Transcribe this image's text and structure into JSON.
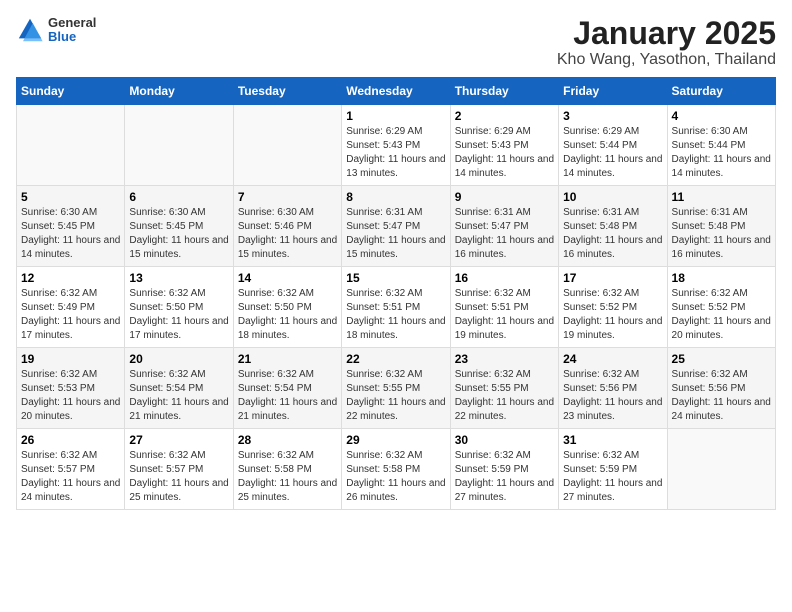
{
  "logo": {
    "general": "General",
    "blue": "Blue"
  },
  "title": "January 2025",
  "subtitle": "Kho Wang, Yasothon, Thailand",
  "days_of_week": [
    "Sunday",
    "Monday",
    "Tuesday",
    "Wednesday",
    "Thursday",
    "Friday",
    "Saturday"
  ],
  "weeks": [
    [
      {
        "day": "",
        "info": ""
      },
      {
        "day": "",
        "info": ""
      },
      {
        "day": "",
        "info": ""
      },
      {
        "day": "1",
        "info": "Sunrise: 6:29 AM\nSunset: 5:43 PM\nDaylight: 11 hours and 13 minutes."
      },
      {
        "day": "2",
        "info": "Sunrise: 6:29 AM\nSunset: 5:43 PM\nDaylight: 11 hours and 14 minutes."
      },
      {
        "day": "3",
        "info": "Sunrise: 6:29 AM\nSunset: 5:44 PM\nDaylight: 11 hours and 14 minutes."
      },
      {
        "day": "4",
        "info": "Sunrise: 6:30 AM\nSunset: 5:44 PM\nDaylight: 11 hours and 14 minutes."
      }
    ],
    [
      {
        "day": "5",
        "info": "Sunrise: 6:30 AM\nSunset: 5:45 PM\nDaylight: 11 hours and 14 minutes."
      },
      {
        "day": "6",
        "info": "Sunrise: 6:30 AM\nSunset: 5:45 PM\nDaylight: 11 hours and 15 minutes."
      },
      {
        "day": "7",
        "info": "Sunrise: 6:30 AM\nSunset: 5:46 PM\nDaylight: 11 hours and 15 minutes."
      },
      {
        "day": "8",
        "info": "Sunrise: 6:31 AM\nSunset: 5:47 PM\nDaylight: 11 hours and 15 minutes."
      },
      {
        "day": "9",
        "info": "Sunrise: 6:31 AM\nSunset: 5:47 PM\nDaylight: 11 hours and 16 minutes."
      },
      {
        "day": "10",
        "info": "Sunrise: 6:31 AM\nSunset: 5:48 PM\nDaylight: 11 hours and 16 minutes."
      },
      {
        "day": "11",
        "info": "Sunrise: 6:31 AM\nSunset: 5:48 PM\nDaylight: 11 hours and 16 minutes."
      }
    ],
    [
      {
        "day": "12",
        "info": "Sunrise: 6:32 AM\nSunset: 5:49 PM\nDaylight: 11 hours and 17 minutes."
      },
      {
        "day": "13",
        "info": "Sunrise: 6:32 AM\nSunset: 5:50 PM\nDaylight: 11 hours and 17 minutes."
      },
      {
        "day": "14",
        "info": "Sunrise: 6:32 AM\nSunset: 5:50 PM\nDaylight: 11 hours and 18 minutes."
      },
      {
        "day": "15",
        "info": "Sunrise: 6:32 AM\nSunset: 5:51 PM\nDaylight: 11 hours and 18 minutes."
      },
      {
        "day": "16",
        "info": "Sunrise: 6:32 AM\nSunset: 5:51 PM\nDaylight: 11 hours and 19 minutes."
      },
      {
        "day": "17",
        "info": "Sunrise: 6:32 AM\nSunset: 5:52 PM\nDaylight: 11 hours and 19 minutes."
      },
      {
        "day": "18",
        "info": "Sunrise: 6:32 AM\nSunset: 5:52 PM\nDaylight: 11 hours and 20 minutes."
      }
    ],
    [
      {
        "day": "19",
        "info": "Sunrise: 6:32 AM\nSunset: 5:53 PM\nDaylight: 11 hours and 20 minutes."
      },
      {
        "day": "20",
        "info": "Sunrise: 6:32 AM\nSunset: 5:54 PM\nDaylight: 11 hours and 21 minutes."
      },
      {
        "day": "21",
        "info": "Sunrise: 6:32 AM\nSunset: 5:54 PM\nDaylight: 11 hours and 21 minutes."
      },
      {
        "day": "22",
        "info": "Sunrise: 6:32 AM\nSunset: 5:55 PM\nDaylight: 11 hours and 22 minutes."
      },
      {
        "day": "23",
        "info": "Sunrise: 6:32 AM\nSunset: 5:55 PM\nDaylight: 11 hours and 22 minutes."
      },
      {
        "day": "24",
        "info": "Sunrise: 6:32 AM\nSunset: 5:56 PM\nDaylight: 11 hours and 23 minutes."
      },
      {
        "day": "25",
        "info": "Sunrise: 6:32 AM\nSunset: 5:56 PM\nDaylight: 11 hours and 24 minutes."
      }
    ],
    [
      {
        "day": "26",
        "info": "Sunrise: 6:32 AM\nSunset: 5:57 PM\nDaylight: 11 hours and 24 minutes."
      },
      {
        "day": "27",
        "info": "Sunrise: 6:32 AM\nSunset: 5:57 PM\nDaylight: 11 hours and 25 minutes."
      },
      {
        "day": "28",
        "info": "Sunrise: 6:32 AM\nSunset: 5:58 PM\nDaylight: 11 hours and 25 minutes."
      },
      {
        "day": "29",
        "info": "Sunrise: 6:32 AM\nSunset: 5:58 PM\nDaylight: 11 hours and 26 minutes."
      },
      {
        "day": "30",
        "info": "Sunrise: 6:32 AM\nSunset: 5:59 PM\nDaylight: 11 hours and 27 minutes."
      },
      {
        "day": "31",
        "info": "Sunrise: 6:32 AM\nSunset: 5:59 PM\nDaylight: 11 hours and 27 minutes."
      },
      {
        "day": "",
        "info": ""
      }
    ]
  ]
}
